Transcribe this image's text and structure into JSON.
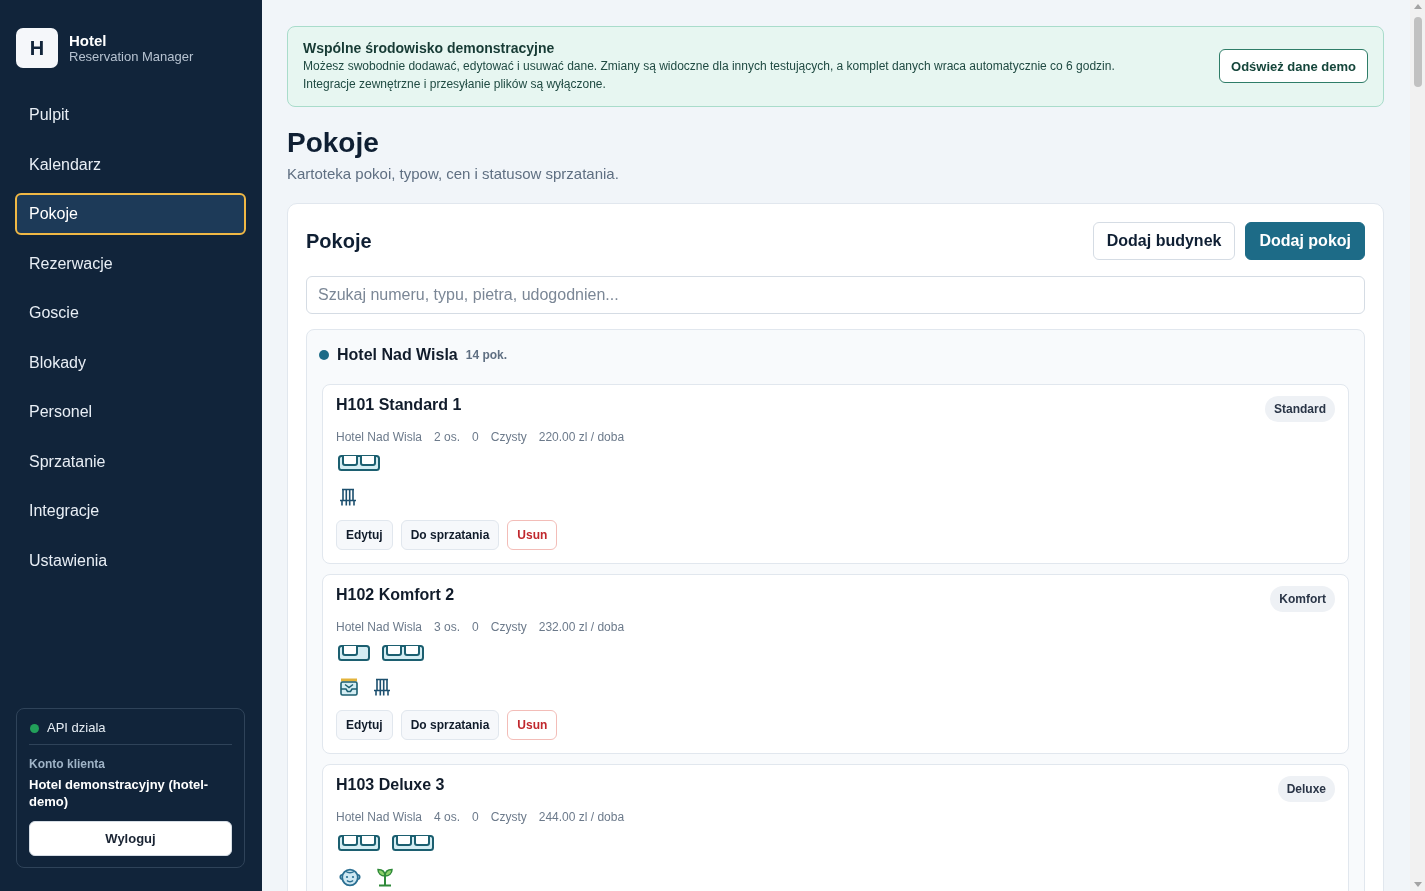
{
  "app": {
    "logo": "H",
    "title": "Hotel",
    "subtitle": "Reservation Manager"
  },
  "sidebar": {
    "items": [
      {
        "label": "Pulpit",
        "selected": false
      },
      {
        "label": "Kalendarz",
        "selected": false
      },
      {
        "label": "Pokoje",
        "selected": true
      },
      {
        "label": "Rezerwacje",
        "selected": false
      },
      {
        "label": "Goscie",
        "selected": false
      },
      {
        "label": "Blokady",
        "selected": false
      },
      {
        "label": "Personel",
        "selected": false
      },
      {
        "label": "Sprzatanie",
        "selected": false
      },
      {
        "label": "Integracje",
        "selected": false
      },
      {
        "label": "Ustawienia",
        "selected": false
      }
    ],
    "status": {
      "label": "API dziala",
      "online": true
    },
    "account": {
      "heading": "Konto klienta",
      "name": "Hotel demonstracyjny (hotel-demo)",
      "button": "Wyloguj"
    }
  },
  "banner": {
    "title": "Wspólne środowisko demonstracyjne",
    "text": "Możesz swobodnie dodawać, edytować i usuwać dane. Zmiany są widoczne dla innych testujących, a komplet danych wraca automatycznie co 6 godzin. Integracje zewnętrzne i przesyłanie plików są wyłączone.",
    "button": "Odśwież dane demo"
  },
  "page": {
    "title": "Pokoje",
    "subtitle": "Kartoteka pokoi, typow, cen i statusow sprzatania."
  },
  "panel": {
    "title": "Pokoje",
    "buttons": [
      {
        "label": "Dodaj budynek",
        "kind": "secondary"
      },
      {
        "label": "Dodaj pokoj",
        "kind": "primary"
      }
    ],
    "search": {
      "placeholder": "Szukaj numeru, typu, pietra, udogodnien..."
    },
    "buildings": [
      {
        "name": "Hotel Nad Wisla",
        "count": "14 pok.",
        "color": "#1d6b87",
        "rooms": [
          {
            "title": "H101 Standard 1",
            "type": "Standard",
            "meta": [
              "Hotel Nad Wisla",
              "2 os.",
              "0",
              "Czysty",
              "220.00 zl / doba"
            ],
            "beds": [
              {
                "kind": "double"
              }
            ],
            "amenities": [
              {
                "kind": "radiator"
              }
            ],
            "actions": [
              {
                "label": "Edytuj",
                "kind": "default"
              },
              {
                "label": "Do sprzatania",
                "kind": "default"
              },
              {
                "label": "Usun",
                "kind": "danger"
              }
            ]
          },
          {
            "title": "H102 Komfort 2",
            "type": "Komfort",
            "meta": [
              "Hotel Nad Wisla",
              "3 os.",
              "0",
              "Czysty",
              "232.00 zl / doba"
            ],
            "beds": [
              {
                "kind": "single"
              },
              {
                "kind": "double"
              }
            ],
            "amenities": [
              {
                "kind": "tray"
              },
              {
                "kind": "radiator"
              }
            ],
            "actions": [
              {
                "label": "Edytuj",
                "kind": "default"
              },
              {
                "label": "Do sprzatania",
                "kind": "default"
              },
              {
                "label": "Usun",
                "kind": "danger"
              }
            ]
          },
          {
            "title": "H103 Deluxe 3",
            "type": "Deluxe",
            "meta": [
              "Hotel Nad Wisla",
              "4 os.",
              "0",
              "Czysty",
              "244.00 zl / doba"
            ],
            "beds": [
              {
                "kind": "double"
              },
              {
                "kind": "double"
              }
            ],
            "amenities": [
              {
                "kind": "face"
              },
              {
                "kind": "plant"
              }
            ]
          }
        ]
      }
    ]
  }
}
